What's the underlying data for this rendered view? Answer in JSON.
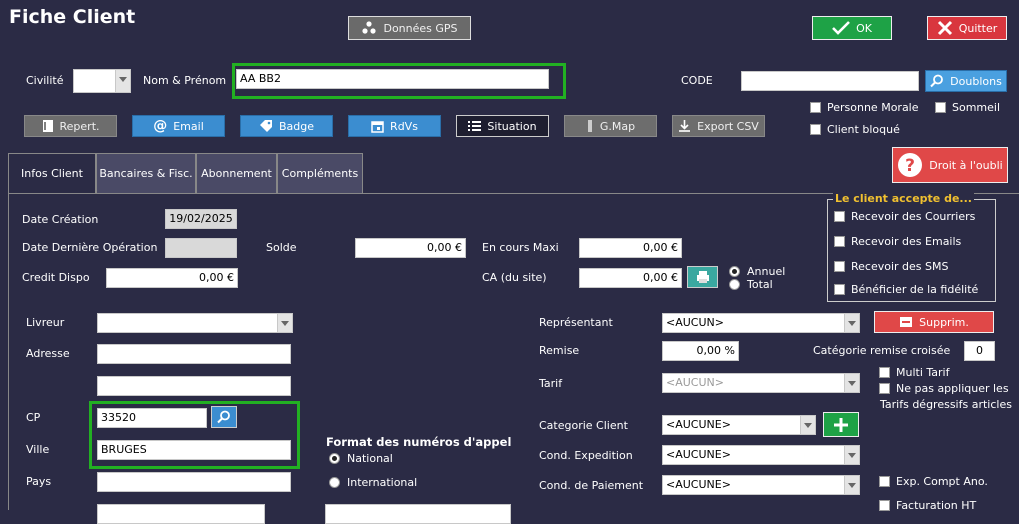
{
  "window": {
    "title": "Fiche Client"
  },
  "header": {
    "gps_label": "Données GPS",
    "ok_label": "OK",
    "quit_label": "Quitter"
  },
  "identity": {
    "civilite_label": "Civilité",
    "civilite_value": "",
    "nom_label": "Nom & Prénom",
    "nom_value": "AA BB2",
    "code_label": "CODE",
    "code_value": "",
    "doublons_label": "Doublons"
  },
  "toolbar": {
    "repert": "Repert.",
    "email": "Email",
    "badge": "Badge",
    "rdvs": "RdVs",
    "situation": "Situation",
    "gmap": "G.Map",
    "export": "Export CSV"
  },
  "flags": {
    "personne_morale": "Personne Morale",
    "sommeil": "Sommeil",
    "client_bloque": "Client bloqué"
  },
  "oubli_label": "Droit à l'oubli",
  "tabs": [
    {
      "label": "Infos Client"
    },
    {
      "label": "Bancaires & Fisc."
    },
    {
      "label": "Abonnement"
    },
    {
      "label": "Compléments"
    }
  ],
  "info": {
    "date_creation_label": "Date Création",
    "date_creation_value": "19/02/2025",
    "date_derniere_label": "Date Dernière Opération",
    "date_derniere_value": "",
    "solde_label": "Solde",
    "solde_value": "0,00 €",
    "encours_label": "En cours Maxi",
    "encours_value": "0,00 €",
    "credit_label": "Credit Dispo",
    "credit_value": "0,00 €",
    "ca_label": "CA (du site)",
    "ca_value": "0,00 €",
    "annuel_label": "Annuel",
    "total_label": "Total"
  },
  "accept": {
    "title": "Le client accepte de...",
    "courriers": "Recevoir des Courriers",
    "emails": "Recevoir des Emails",
    "sms": "Recevoir des SMS",
    "fidelite": "Bénéficier de la fidélité"
  },
  "address": {
    "livreur_label": "Livreur",
    "livreur_value": "",
    "adresse_label": "Adresse",
    "adresse1": "",
    "adresse2": "",
    "cp_label": "CP",
    "cp_value": "33520",
    "ville_label": "Ville",
    "ville_value": "BRUGES",
    "pays_label": "Pays",
    "pays_value": ""
  },
  "phone_format": {
    "title": "Format des numéros d'appel",
    "national": "National",
    "international": "International"
  },
  "commercial": {
    "representant_label": "Représentant",
    "representant_value": "<AUCUN>",
    "supprim_label": "Supprim.",
    "remise_label": "Remise",
    "remise_value": "0,00 %",
    "cat_remise_label": "Catégorie remise croisée",
    "cat_remise_value": "0",
    "tarif_label": "Tarif",
    "tarif_value": "<AUCUN>",
    "multi_tarif": "Multi Tarif",
    "ne_pas_appliquer": "Ne pas appliquer les",
    "tarifs_degressifs": "Tarifs dégressifs articles",
    "categorie_client_label": "Categorie Client",
    "categorie_client_value": "<AUCUNE>",
    "cond_exp_label": "Cond. Expedition",
    "cond_exp_value": "<AUCUNE>",
    "cond_paie_label": "Cond. de Paiement",
    "cond_paie_value": "<AUCUNE>",
    "exp_compt": "Exp. Compt Ano.",
    "facturation_ht": "Facturation HT"
  }
}
